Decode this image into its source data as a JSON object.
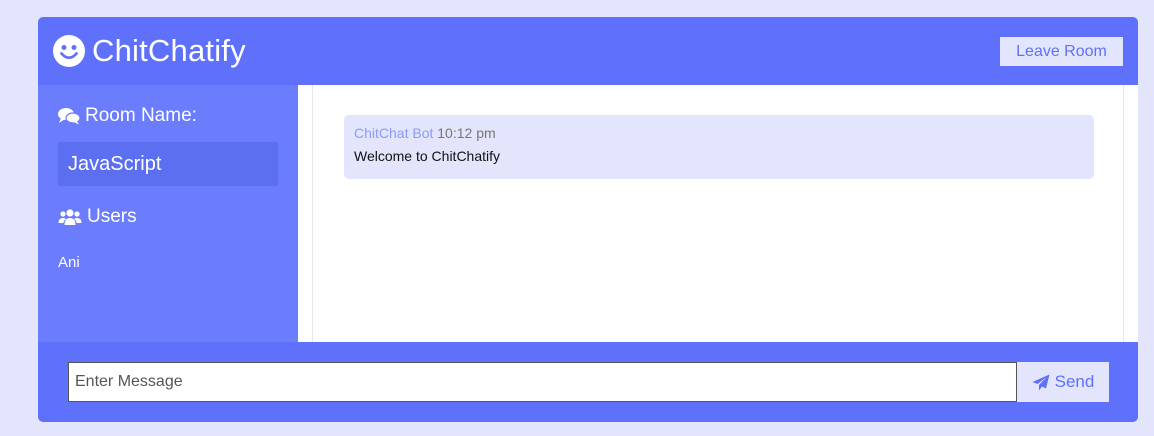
{
  "header": {
    "logo_icon": "smiley-face-icon",
    "title": "ChitChatify",
    "leave_button": "Leave Room"
  },
  "sidebar": {
    "room_icon": "comments-icon",
    "room_heading": "Room Name:",
    "room_name": "JavaScript",
    "users_icon": "users-icon",
    "users_heading": "Users",
    "users": [
      "Ani"
    ]
  },
  "messages": [
    {
      "username": "ChitChat Bot",
      "time": "10:12 pm",
      "text": "Welcome to ChitChatify"
    }
  ],
  "footer": {
    "input_placeholder": "Enter Message",
    "input_value": "",
    "send_icon": "paper-plane-icon",
    "send_label": "Send"
  },
  "colors": {
    "primary": "#5f71fb",
    "sidebar": "#6b7cfc",
    "light": "#e2e5fb",
    "username": "#8d9bfb"
  }
}
